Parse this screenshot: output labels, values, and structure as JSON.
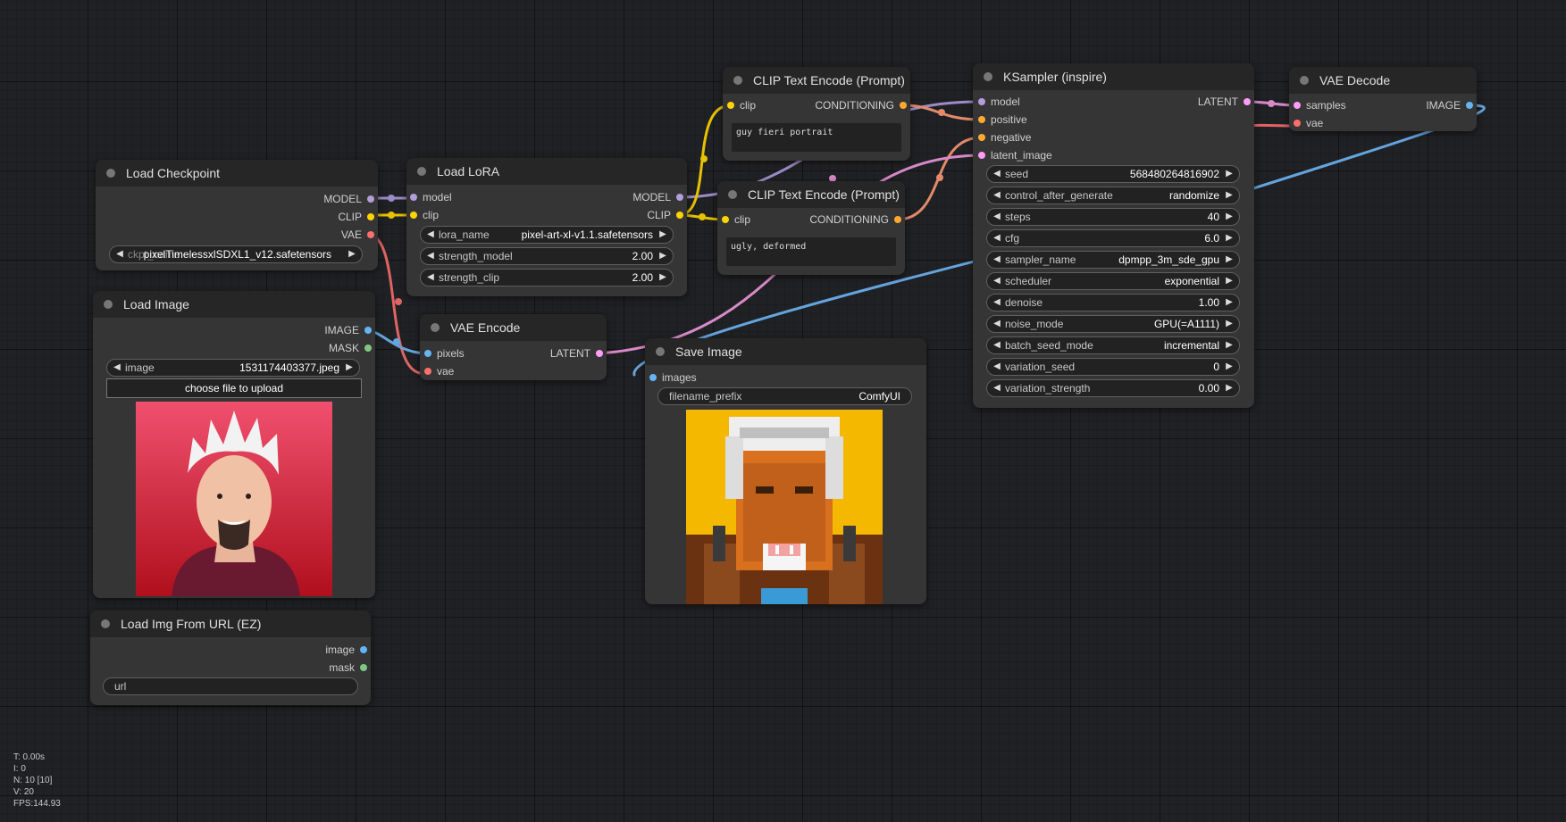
{
  "colors": {
    "model": "#b39ddb",
    "clip": "#ffd500",
    "vae": "#ff6e6e",
    "image": "#64b5f6",
    "mask": "#81c784",
    "latent": "#ff9cf9",
    "conditioning": "#ffa931",
    "int_pin": "#aaaaaa"
  },
  "nodes": {
    "load_checkpoint": {
      "title": "Load Checkpoint",
      "outputs": [
        "MODEL",
        "CLIP",
        "VAE"
      ],
      "ckpt_label": "ckpt_name",
      "ckpt_value": "pixelTimelessxlSDXL1_v12.safetensors"
    },
    "load_lora": {
      "title": "Load LoRA",
      "inputs": [
        "model",
        "clip"
      ],
      "outputs": [
        "MODEL",
        "CLIP"
      ],
      "widgets": [
        {
          "label": "lora_name",
          "value": "pixel-art-xl-v1.1.safetensors"
        },
        {
          "label": "strength_model",
          "value": "2.00"
        },
        {
          "label": "strength_clip",
          "value": "2.00"
        }
      ]
    },
    "clip_pos": {
      "title": "CLIP Text Encode (Prompt)",
      "input": "clip",
      "output": "CONDITIONING",
      "text": "guy fieri portrait"
    },
    "clip_neg": {
      "title": "CLIP Text Encode (Prompt)",
      "input": "clip",
      "output": "CONDITIONING",
      "text": "ugly, deformed"
    },
    "ksampler": {
      "title": "KSampler (inspire)",
      "inputs": [
        "model",
        "positive",
        "negative",
        "latent_image"
      ],
      "output": "LATENT",
      "widgets": [
        {
          "label": "seed",
          "value": "568480264816902"
        },
        {
          "label": "control_after_generate",
          "value": "randomize"
        },
        {
          "label": "steps",
          "value": "40"
        },
        {
          "label": "cfg",
          "value": "6.0"
        },
        {
          "label": "sampler_name",
          "value": "dpmpp_3m_sde_gpu"
        },
        {
          "label": "scheduler",
          "value": "exponential"
        },
        {
          "label": "denoise",
          "value": "1.00"
        },
        {
          "label": "noise_mode",
          "value": "GPU(=A1111)"
        },
        {
          "label": "batch_seed_mode",
          "value": "incremental"
        },
        {
          "label": "variation_seed",
          "value": "0"
        },
        {
          "label": "variation_strength",
          "value": "0.00"
        }
      ]
    },
    "vae_decode": {
      "title": "VAE Decode",
      "inputs": [
        "samples",
        "vae"
      ],
      "output": "IMAGE"
    },
    "load_image": {
      "title": "Load Image",
      "outputs": [
        "IMAGE",
        "MASK"
      ],
      "image_label": "image",
      "image_value": "1531174403377.jpeg",
      "upload_label": "choose file to upload"
    },
    "vae_encode": {
      "title": "VAE Encode",
      "inputs": [
        "pixels",
        "vae"
      ],
      "output": "LATENT"
    },
    "save_image": {
      "title": "Save Image",
      "input": "images",
      "prefix_label": "filename_prefix",
      "prefix_value": "ComfyUI"
    },
    "load_url": {
      "title": "Load Img From URL (EZ)",
      "outputs": [
        "image",
        "mask"
      ],
      "url_placeholder": "url"
    }
  },
  "stats": [
    "T: 0.00s",
    "I: 0",
    "N: 10 [10]",
    "V: 20",
    "FPS:144.93"
  ]
}
